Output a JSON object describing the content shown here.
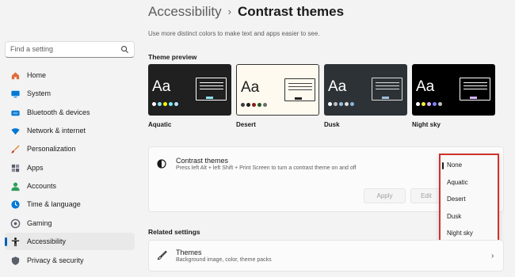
{
  "search": {
    "placeholder": "Find a setting",
    "icon": "search-icon"
  },
  "sidebar": {
    "items": [
      {
        "label": "Home",
        "icon": "home-icon",
        "color": "#e06c3c",
        "active": false
      },
      {
        "label": "System",
        "icon": "monitor-icon",
        "color": "#0078d4",
        "active": false
      },
      {
        "label": "Bluetooth & devices",
        "icon": "bluetooth-icon",
        "color": "#0078d4",
        "active": false
      },
      {
        "label": "Network & internet",
        "icon": "wifi-icon",
        "color": "#0078d4",
        "active": false
      },
      {
        "label": "Personalization",
        "icon": "brush-icon",
        "color": "#e0862b",
        "active": false
      },
      {
        "label": "Apps",
        "icon": "apps-icon",
        "color": "#5a5f6b",
        "active": false
      },
      {
        "label": "Accounts",
        "icon": "person-icon",
        "color": "#2e9d5a",
        "active": false
      },
      {
        "label": "Time & language",
        "icon": "globe-clock-icon",
        "color": "#0078d4",
        "active": false
      },
      {
        "label": "Gaming",
        "icon": "gamepad-icon",
        "color": "#5a5f6b",
        "active": false
      },
      {
        "label": "Accessibility",
        "icon": "accessibility-icon",
        "color": "#1a1a1a",
        "active": true
      },
      {
        "label": "Privacy & security",
        "icon": "shield-icon",
        "color": "#5a5f6b",
        "active": false
      }
    ]
  },
  "breadcrumb": {
    "parent": "Accessibility",
    "separator": "›",
    "current": "Contrast themes"
  },
  "subtitle": "Use more distinct colors to make text and apps easier to see.",
  "theme_preview": {
    "label": "Theme preview",
    "themes": [
      {
        "name": "Aquatic",
        "sample": "Aa"
      },
      {
        "name": "Desert",
        "sample": "Aa"
      },
      {
        "name": "Dusk",
        "sample": "Aa"
      },
      {
        "name": "Night sky",
        "sample": "Aa"
      }
    ]
  },
  "contrast_themes": {
    "title": "Contrast themes",
    "description": "Press left Alt + left Shift + Print Screen to turn a contrast theme on and off",
    "apply_label": "Apply",
    "edit_label": "Edit",
    "dropdown": {
      "options": [
        "None",
        "Aquatic",
        "Desert",
        "Dusk",
        "Night sky"
      ],
      "selected": "None"
    }
  },
  "related": {
    "label": "Related settings",
    "themes_title": "Themes",
    "themes_desc": "Background image, color, theme packs",
    "chevron": "›"
  },
  "colors": {
    "accent": "#005fb8",
    "highlight_box": "#d0312d"
  }
}
